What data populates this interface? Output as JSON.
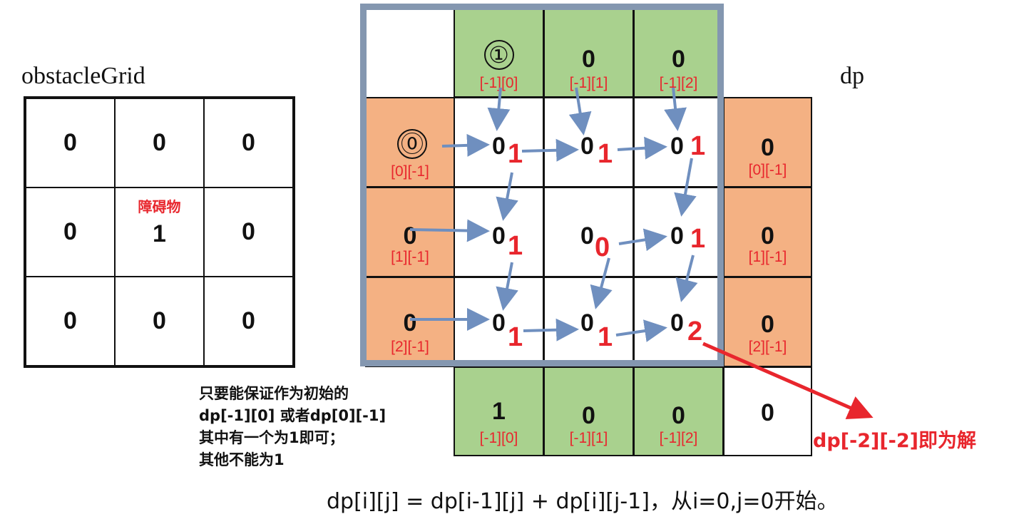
{
  "labels": {
    "obstacle_grid_title": "obstacleGrid",
    "dp_title": "dp",
    "obstacle_tag": "障碍物"
  },
  "obstacle_grid": {
    "rows": [
      [
        "0",
        "0",
        "0"
      ],
      [
        "0",
        "1",
        "0"
      ],
      [
        "0",
        "0",
        "0"
      ]
    ]
  },
  "dp": {
    "top_row": [
      {
        "value": "①",
        "index": "[-1][0]"
      },
      {
        "value": "0",
        "index": "[-1][1]"
      },
      {
        "value": "0",
        "index": "[-1][2]"
      }
    ],
    "left_col": [
      {
        "value": "⓪",
        "index": "[0][-1]"
      },
      {
        "value": "0",
        "index": "[1][-1]"
      },
      {
        "value": "0",
        "index": "[2][-1]"
      }
    ],
    "right_col": [
      {
        "value": "0",
        "index": "[0][-1]"
      },
      {
        "value": "0",
        "index": "[1][-1]"
      },
      {
        "value": "0",
        "index": "[2][-1]"
      }
    ],
    "bottom_row": [
      {
        "value": "1",
        "index": "[-1][0]"
      },
      {
        "value": "0",
        "index": "[-1][1]"
      },
      {
        "value": "0",
        "index": "[-1][2]"
      }
    ],
    "corner": "0",
    "inner_initial": [
      [
        "0",
        "0",
        "0"
      ],
      [
        "0",
        "0",
        "0"
      ],
      [
        "0",
        "0",
        "0"
      ]
    ],
    "inner_computed": [
      [
        "1",
        "1",
        "1"
      ],
      [
        "1",
        "0",
        "1"
      ],
      [
        "1",
        "1",
        "2"
      ]
    ]
  },
  "note_lines": [
    "只要能保证作为初始的",
    "dp[-1][0] 或者dp[0][-1]",
    "其中有一个为1即可；",
    "其他不能为1"
  ],
  "answer": "dp[-2][-2]即为解",
  "formula": "dp[i][j] = dp[i-1][j] + dp[i][j-1]，从i=0,j=0开始。",
  "colors": {
    "green": "#a9d18e",
    "orange": "#f4b183",
    "frame": "#8497b0",
    "red": "#e8262d",
    "arrow": "#6f8fbf"
  }
}
